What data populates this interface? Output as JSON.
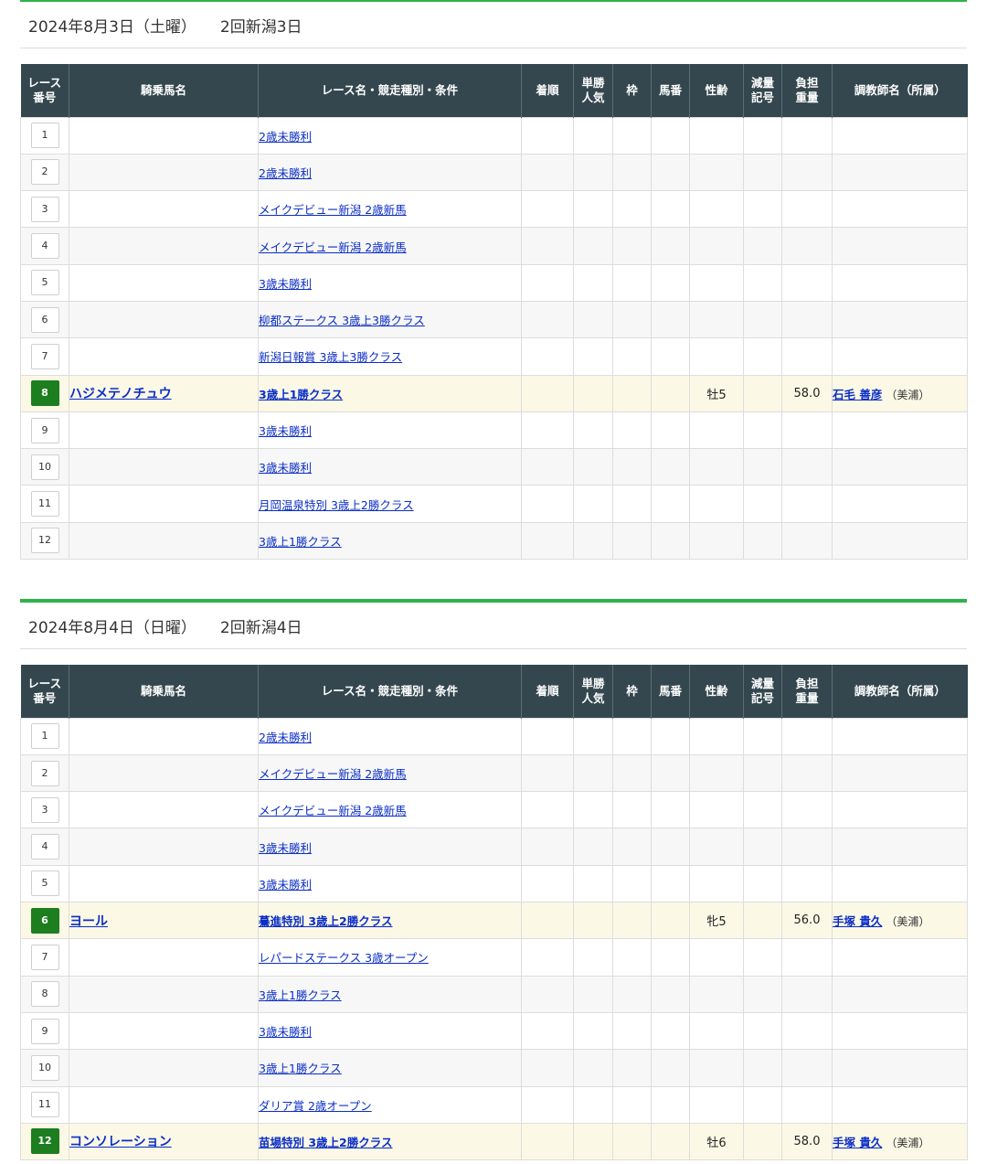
{
  "columns": [
    "レース\n番号",
    "騎乗馬名",
    "レース名・競走種別・条件",
    "着順",
    "単勝\n人気",
    "枠",
    "馬番",
    "性齢",
    "減量\n記号",
    "負担\n重量",
    "調教師名（所属）"
  ],
  "days": [
    {
      "date": "2024年8月3日（土曜）",
      "meet": "2回新潟3日",
      "races": [
        {
          "no": "1",
          "race": "2歳未勝利"
        },
        {
          "no": "2",
          "race": "2歳未勝利"
        },
        {
          "no": "3",
          "race": "メイクデビュー新潟  2歳新馬"
        },
        {
          "no": "4",
          "race": "メイクデビュー新潟  2歳新馬"
        },
        {
          "no": "5",
          "race": "3歳未勝利"
        },
        {
          "no": "6",
          "race": "柳都ステークス  3歳上3勝クラス"
        },
        {
          "no": "7",
          "race": "新潟日報賞  3歳上3勝クラス"
        },
        {
          "no": "8",
          "race": "3歳上1勝クラス",
          "highlight": true,
          "horse": "ハジメテノチュウ",
          "sex_age": "牡5",
          "weight": "58.0",
          "trainer": "石毛 善彦",
          "affiliation": "（美浦）"
        },
        {
          "no": "9",
          "race": "3歳未勝利"
        },
        {
          "no": "10",
          "race": "3歳未勝利"
        },
        {
          "no": "11",
          "race": "月岡温泉特別  3歳上2勝クラス"
        },
        {
          "no": "12",
          "race": "3歳上1勝クラス"
        }
      ]
    },
    {
      "date": "2024年8月4日（日曜）",
      "meet": "2回新潟4日",
      "races": [
        {
          "no": "1",
          "race": "2歳未勝利"
        },
        {
          "no": "2",
          "race": "メイクデビュー新潟  2歳新馬"
        },
        {
          "no": "3",
          "race": "メイクデビュー新潟  2歳新馬"
        },
        {
          "no": "4",
          "race": "3歳未勝利"
        },
        {
          "no": "5",
          "race": "3歳未勝利"
        },
        {
          "no": "6",
          "race": "驀進特別  3歳上2勝クラス",
          "highlight": true,
          "horse": "ヨール",
          "sex_age": "牝5",
          "weight": "56.0",
          "trainer": "手塚 貴久",
          "affiliation": "（美浦）"
        },
        {
          "no": "7",
          "race": "レパードステークス  3歳オープン"
        },
        {
          "no": "8",
          "race": "3歳上1勝クラス"
        },
        {
          "no": "9",
          "race": "3歳未勝利"
        },
        {
          "no": "10",
          "race": "3歳上1勝クラス"
        },
        {
          "no": "11",
          "race": "ダリア賞  2歳オープン"
        },
        {
          "no": "12",
          "race": "苗場特別  3歳上2勝クラス",
          "highlight": true,
          "horse": "コンソレーション",
          "sex_age": "牡6",
          "weight": "58.0",
          "trainer": "手塚 貴久",
          "affiliation": "（美浦）"
        }
      ]
    }
  ]
}
